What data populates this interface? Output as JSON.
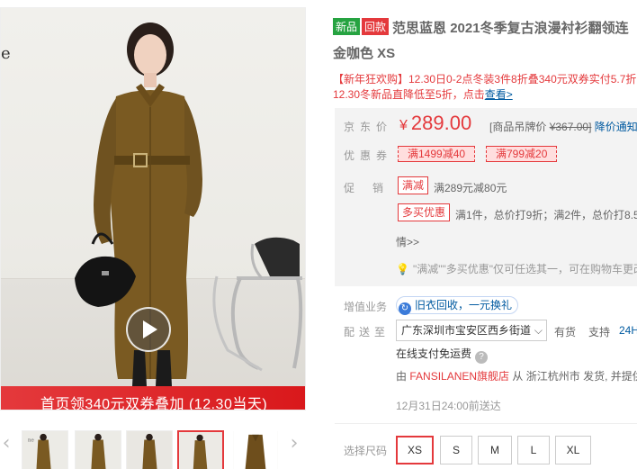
{
  "gallery": {
    "banner_text": "首页领340元双券叠加 (12.30当天)",
    "edge_letter": "e",
    "prev_arrow": "‹",
    "next_arrow": "›",
    "active_thumb_index": 3
  },
  "product": {
    "tag_new": "新品",
    "tag_arrival": "回款",
    "title_line1": "范思蓝恩 2021冬季复古浪漫衬衫翻领连",
    "title_line2": "金咖色 XS",
    "promo_line1": "【新年狂欢购】12.30日0-2点冬装3件8折叠340元双券实付5.7折",
    "promo_line2": "12.30冬新品直降低至5折，点击",
    "promo_link": "查看>"
  },
  "price": {
    "label": "京东价",
    "currency": "¥",
    "value": "289.00",
    "tag_label": "[商品吊牌价",
    "tag_value": "¥367.00]",
    "notice": "降价通知"
  },
  "coupons": {
    "label": "优惠券",
    "items": [
      "满1499减40",
      "满799减20"
    ]
  },
  "promotion": {
    "label": "促销",
    "badge1": "满减",
    "desc1": "满289元减80元",
    "badge2": "多买优惠",
    "desc2": "满1件，总价打9折；满2件，总价打8.5",
    "detail": "情>>",
    "hint": "\"满减\"\"多买优惠\"仅可任选其一，可在购物车更改"
  },
  "value_added": {
    "label": "增值业务",
    "recycle_icon": "↻",
    "recycle_text": "旧衣回收，一元换礼"
  },
  "delivery": {
    "label": "配送至",
    "address": "广东深圳市宝安区西乡街道",
    "stock": "有货",
    "support": "支持",
    "support_link": "24H",
    "payment": "在线支付免运费",
    "from_prefix": "由",
    "shop": "FANSILANEN旗舰店",
    "from_suffix": "从 浙江杭州市 发货, 并提供",
    "deadline": "12月31日24:00前送达"
  },
  "sizes": {
    "label": "选择尺码",
    "options": [
      "XS",
      "S",
      "M",
      "L",
      "XL"
    ],
    "selected": "XS"
  },
  "colors": {
    "accent": "#e4393c",
    "link": "#005aa0",
    "tag_green": "#26a341",
    "coat": "#7a5a22"
  }
}
